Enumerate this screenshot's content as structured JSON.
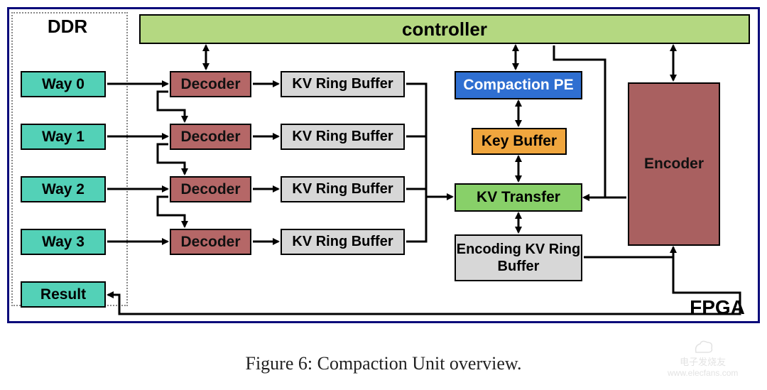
{
  "figure": {
    "caption": "Figure 6: Compaction Unit overview.",
    "ddr_label": "DDR",
    "fpga_label": "FPGA"
  },
  "blocks": {
    "controller": "controller",
    "way0": "Way 0",
    "way1": "Way 1",
    "way2": "Way 2",
    "way3": "Way 3",
    "result": "Result",
    "decoder0": "Decoder",
    "decoder1": "Decoder",
    "decoder2": "Decoder",
    "decoder3": "Decoder",
    "ringbuf0": "KV Ring Buffer",
    "ringbuf1": "KV Ring Buffer",
    "ringbuf2": "KV Ring Buffer",
    "ringbuf3": "KV Ring Buffer",
    "compaction_pe": "Compaction PE",
    "key_buffer": "Key Buffer",
    "kv_transfer": "KV Transfer",
    "enc_ringbuf": "Encoding KV Ring Buffer",
    "encoder": "Encoder"
  },
  "colors": {
    "controller": "#b4d881",
    "way": "#53d1b7",
    "decoder": "#b56767",
    "ringbuf": "#d7d7d7",
    "compaction_pe": "#2f6fd1",
    "compaction_pe_text": "#ffffff",
    "key_buffer": "#f0a63e",
    "kv_transfer": "#88d069",
    "encoder": "#a96060"
  },
  "watermark": {
    "name": "电子发烧友",
    "url": "www.elecfans.com"
  },
  "chart_data": {
    "type": "diagram",
    "title": "Compaction Unit overview",
    "nodes": [
      {
        "id": "DDR",
        "kind": "region"
      },
      {
        "id": "FPGA",
        "kind": "region"
      },
      {
        "id": "Way0",
        "label": "Way 0",
        "region": "DDR"
      },
      {
        "id": "Way1",
        "label": "Way 1",
        "region": "DDR"
      },
      {
        "id": "Way2",
        "label": "Way 2",
        "region": "DDR"
      },
      {
        "id": "Way3",
        "label": "Way 3",
        "region": "DDR"
      },
      {
        "id": "Result",
        "label": "Result",
        "region": "DDR"
      },
      {
        "id": "controller",
        "label": "controller",
        "region": "FPGA"
      },
      {
        "id": "Decoder0",
        "label": "Decoder",
        "region": "FPGA"
      },
      {
        "id": "Decoder1",
        "label": "Decoder",
        "region": "FPGA"
      },
      {
        "id": "Decoder2",
        "label": "Decoder",
        "region": "FPGA"
      },
      {
        "id": "Decoder3",
        "label": "Decoder",
        "region": "FPGA"
      },
      {
        "id": "RingBuf0",
        "label": "KV Ring Buffer",
        "region": "FPGA"
      },
      {
        "id": "RingBuf1",
        "label": "KV Ring Buffer",
        "region": "FPGA"
      },
      {
        "id": "RingBuf2",
        "label": "KV Ring Buffer",
        "region": "FPGA"
      },
      {
        "id": "RingBuf3",
        "label": "KV Ring Buffer",
        "region": "FPGA"
      },
      {
        "id": "CompactionPE",
        "label": "Compaction PE",
        "region": "FPGA"
      },
      {
        "id": "KeyBuffer",
        "label": "Key Buffer",
        "region": "FPGA"
      },
      {
        "id": "KVTransfer",
        "label": "KV Transfer",
        "region": "FPGA"
      },
      {
        "id": "EncRingBuf",
        "label": "Encoding KV Ring Buffer",
        "region": "FPGA"
      },
      {
        "id": "Encoder",
        "label": "Encoder",
        "region": "FPGA"
      }
    ],
    "edges": [
      {
        "from": "Way0",
        "to": "Decoder0",
        "bidir": false
      },
      {
        "from": "Way1",
        "to": "Decoder1",
        "bidir": false
      },
      {
        "from": "Way2",
        "to": "Decoder2",
        "bidir": false
      },
      {
        "from": "Way3",
        "to": "Decoder3",
        "bidir": false
      },
      {
        "from": "Decoder0",
        "to": "Decoder1",
        "bidir": false
      },
      {
        "from": "Decoder1",
        "to": "Decoder2",
        "bidir": false
      },
      {
        "from": "Decoder2",
        "to": "Decoder3",
        "bidir": false
      },
      {
        "from": "Decoder0",
        "to": "RingBuf0",
        "bidir": false
      },
      {
        "from": "Decoder1",
        "to": "RingBuf1",
        "bidir": false
      },
      {
        "from": "Decoder2",
        "to": "RingBuf2",
        "bidir": false
      },
      {
        "from": "Decoder3",
        "to": "RingBuf3",
        "bidir": false
      },
      {
        "from": "RingBuf0",
        "to": "KVTransfer",
        "bidir": false
      },
      {
        "from": "RingBuf1",
        "to": "KVTransfer",
        "bidir": false
      },
      {
        "from": "RingBuf2",
        "to": "KVTransfer",
        "bidir": false
      },
      {
        "from": "RingBuf3",
        "to": "KVTransfer",
        "bidir": false
      },
      {
        "from": "controller",
        "to": "Decoder0",
        "bidir": true
      },
      {
        "from": "controller",
        "to": "CompactionPE",
        "bidir": true
      },
      {
        "from": "controller",
        "to": "KVTransfer",
        "bidir": false,
        "via": "down-right"
      },
      {
        "from": "controller",
        "to": "Encoder",
        "bidir": true
      },
      {
        "from": "CompactionPE",
        "to": "KeyBuffer",
        "bidir": true
      },
      {
        "from": "KeyBuffer",
        "to": "KVTransfer",
        "bidir": true
      },
      {
        "from": "KVTransfer",
        "to": "EncRingBuf",
        "bidir": true
      },
      {
        "from": "KVTransfer",
        "to": "Encoder",
        "bidir": false,
        "reverse": true
      },
      {
        "from": "EncRingBuf",
        "to": "Encoder",
        "bidir": false
      },
      {
        "from": "Encoder",
        "to": "Result",
        "bidir": false,
        "routed": "below-fpga"
      }
    ]
  }
}
